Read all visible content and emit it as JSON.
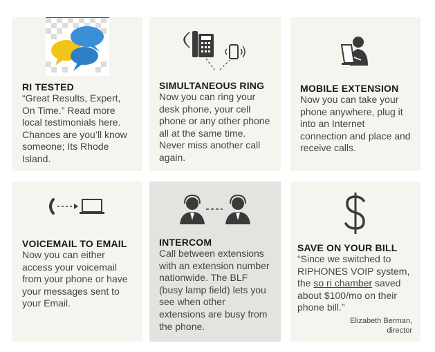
{
  "cards": [
    {
      "title": "RI TESTED",
      "body": "“Great Results, Expert, On Time.” Read more local testimonials here. Chances are you’ll know someone; Its Rhode Island.",
      "icon": "speech-bubbles-icon"
    },
    {
      "title": "SIMULTANEOUS RING",
      "body": "Now you can ring your desk phone, your cell phone or any other phone all at the same time. Never miss another call again.",
      "icon": "desk-and-cell-phone-icon"
    },
    {
      "title": "MOBILE EXTENSION",
      "body": "Now you can take your phone anywhere, plug it into an Internet connection and place and receive calls.",
      "icon": "person-at-laptop-icon"
    },
    {
      "title": "VOICEMAIL TO EMAIL",
      "body": "Now you can either access your voicemail from your phone or have your messages sent to your Email.",
      "icon": "phone-to-laptop-icon"
    },
    {
      "title": "INTERCOM",
      "body": "Call between extensions with an extension number nationwide. The BLF (busy lamp field) lets you see when other extensions are busy from the phone.",
      "icon": "two-headset-agents-icon"
    },
    {
      "title": "SAVE ON YOUR BILL",
      "body_before": "“Since we switched to RIPHONES VOIP system, the ",
      "body_link": "so ri chamber",
      "body_after": " saved about $100/mo on their phone bill.”",
      "author": "Elizabeth Berman,",
      "author_role": "director",
      "icon": "dollar-sign-icon"
    }
  ],
  "colors": {
    "card_bg": "#f6f4ef",
    "card_highlight_bg": "#e3e3e0",
    "icon_dark": "#3a3a3a",
    "bubble_blue": "#3a8fd6",
    "bubble_yellow": "#f4c318"
  }
}
